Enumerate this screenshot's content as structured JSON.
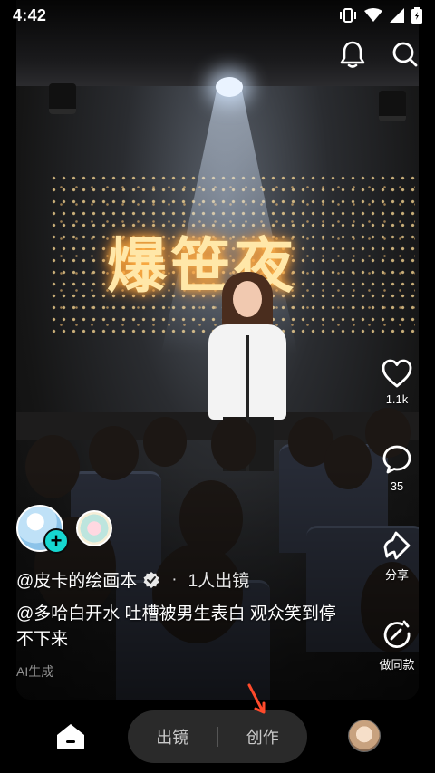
{
  "status_bar": {
    "time": "4:42"
  },
  "video": {
    "marquee_text": "爆笹夜",
    "author": "@皮卡的绘画本",
    "separator": "·",
    "participants": "1人出镜",
    "caption": "@多哈白开水 吐槽被男生表白 观众笑到停不下来",
    "ai_tag": "AI生成"
  },
  "actions": {
    "like_count": "1.1k",
    "comment_count": "35",
    "share_label": "分享",
    "same_label": "做同款"
  },
  "bottom_nav": {
    "appear_label": "出镜",
    "create_label": "创作"
  },
  "colors": {
    "follow_accent": "#16d7d0",
    "arrow": "#ff4a2b",
    "pill_bg": "#2a2a2a"
  }
}
